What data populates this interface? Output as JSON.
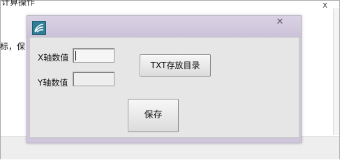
{
  "background": {
    "top_text": "计算操作",
    "side_text": "标，保",
    "corner_mark": "x"
  },
  "dialog": {
    "icon": "app-logo-icon",
    "close_glyph": "✕",
    "x_label": "X轴数值",
    "x_value": "",
    "y_label": "Y轴数值",
    "y_value": "",
    "txt_dir_button": "TXT存放目录",
    "save_button": "保存"
  },
  "colors": {
    "title_bar": "#cfc6db",
    "client_bg": "#e6e6e6",
    "icon_bg": "#2f7e95"
  }
}
